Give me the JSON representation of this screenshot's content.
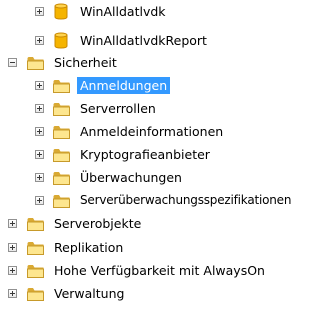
{
  "tree": {
    "items": [
      {
        "label": "WinAlldatlvdk",
        "level": 2,
        "expander": "plus",
        "icon": "database-icon",
        "selected": false
      },
      {
        "label": "WinAlldatlvdkReport",
        "level": 2,
        "expander": "plus",
        "icon": "database-icon",
        "selected": false
      },
      {
        "label": "Sicherheit",
        "level": 0,
        "expander": "minus",
        "icon": "folder-icon",
        "selected": false
      },
      {
        "label": "Anmeldungen",
        "level": 1,
        "expander": "plus",
        "icon": "folder-icon",
        "selected": true
      },
      {
        "label": "Serverrollen",
        "level": 1,
        "expander": "plus",
        "icon": "folder-icon",
        "selected": false
      },
      {
        "label": "Anmeldeinformationen",
        "level": 1,
        "expander": "plus",
        "icon": "folder-icon",
        "selected": false
      },
      {
        "label": "Kryptografieanbieter",
        "level": 1,
        "expander": "plus",
        "icon": "folder-icon",
        "selected": false
      },
      {
        "label": "Überwachungen",
        "level": 1,
        "expander": "plus",
        "icon": "folder-icon",
        "selected": false
      },
      {
        "label": "Serverüberwachungsspezifikationen",
        "level": 1,
        "expander": "plus",
        "icon": "folder-icon",
        "selected": false
      },
      {
        "label": "Serverobjekte",
        "level": 0,
        "expander": "plus",
        "icon": "folder-icon",
        "selected": false
      },
      {
        "label": "Replikation",
        "level": 0,
        "expander": "plus",
        "icon": "folder-icon",
        "selected": false
      },
      {
        "label": "Hohe Verfügbarkeit mit AlwaysOn",
        "level": 0,
        "expander": "plus",
        "icon": "folder-icon",
        "selected": false
      },
      {
        "label": "Verwaltung",
        "level": 0,
        "expander": "plus",
        "icon": "folder-icon",
        "selected": false
      }
    ]
  },
  "colors": {
    "selection": "#3399ff",
    "folder_light": "#fde68f",
    "folder_dark": "#d9a933",
    "database": "#f5b400"
  }
}
